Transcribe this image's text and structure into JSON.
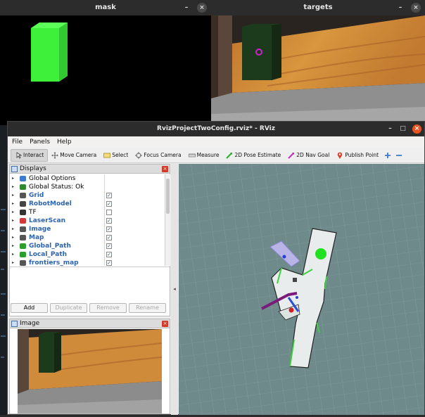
{
  "mask_window": {
    "title": "mask",
    "min": "–",
    "close": "×"
  },
  "targets_window": {
    "title": "targets",
    "min": "–",
    "close": "×"
  },
  "rviz": {
    "title": "RvizProjectTwoConfig.rviz* - RViz",
    "win_min": "–",
    "win_max": "□",
    "win_close": "×",
    "menu": [
      "File",
      "Panels",
      "Help"
    ],
    "tools": [
      {
        "label": "Interact",
        "icon": "interact-icon",
        "color": "#e8c35a"
      },
      {
        "label": "Move Camera",
        "icon": "move-camera-icon",
        "color": "#777777"
      },
      {
        "label": "Select",
        "icon": "select-icon",
        "color": "#e0c24e"
      },
      {
        "label": "Focus Camera",
        "icon": "focus-camera-icon",
        "color": "#777777"
      },
      {
        "label": "Measure",
        "icon": "measure-icon",
        "color": "#999999"
      },
      {
        "label": "2D Pose Estimate",
        "icon": "pose-estimate-icon",
        "color": "#28b028"
      },
      {
        "label": "2D Nav Goal",
        "icon": "nav-goal-icon",
        "color": "#c030c0"
      },
      {
        "label": "Publish Point",
        "icon": "publish-point-icon",
        "color": "#d6422a"
      }
    ],
    "displays": {
      "title": "Displays",
      "items": [
        {
          "label": "Global Options",
          "style": "plain",
          "icon": "gear-icon",
          "color": "#3b7bd0",
          "check": ""
        },
        {
          "label": "Global Status: Ok",
          "style": "plain",
          "icon": "check-icon",
          "color": "#2d8a2d",
          "check": ""
        },
        {
          "label": "Grid",
          "style": "blue",
          "icon": "grid-icon",
          "color": "#555555",
          "check": "✓"
        },
        {
          "label": "RobotModel",
          "style": "blue",
          "icon": "robot-icon",
          "color": "#444444",
          "check": "✓"
        },
        {
          "label": "TF",
          "style": "plain",
          "icon": "tf-icon",
          "color": "#333333",
          "check": " "
        },
        {
          "label": "LaserScan",
          "style": "blue",
          "icon": "laser-icon",
          "color": "#d43a3a",
          "check": "✓"
        },
        {
          "label": "Image",
          "style": "blue",
          "icon": "image-icon",
          "color": "#555555",
          "check": "✓"
        },
        {
          "label": "Map",
          "style": "blue",
          "icon": "map-icon",
          "color": "#555555",
          "check": "✓"
        },
        {
          "label": "Global_Path",
          "style": "blue",
          "icon": "path-icon",
          "color": "#2aa02a",
          "check": "✓"
        },
        {
          "label": "Local_Path",
          "style": "blue",
          "icon": "path-icon",
          "color": "#2aa02a",
          "check": "✓"
        },
        {
          "label": "frontiers_map",
          "style": "blue",
          "icon": "map-icon",
          "color": "#555555",
          "check": "✓"
        }
      ],
      "buttons": [
        "Add",
        "Duplicate",
        "Remove",
        "Rename"
      ]
    },
    "image_panel": {
      "title": "Image"
    },
    "collapse_arrow": "◂"
  }
}
